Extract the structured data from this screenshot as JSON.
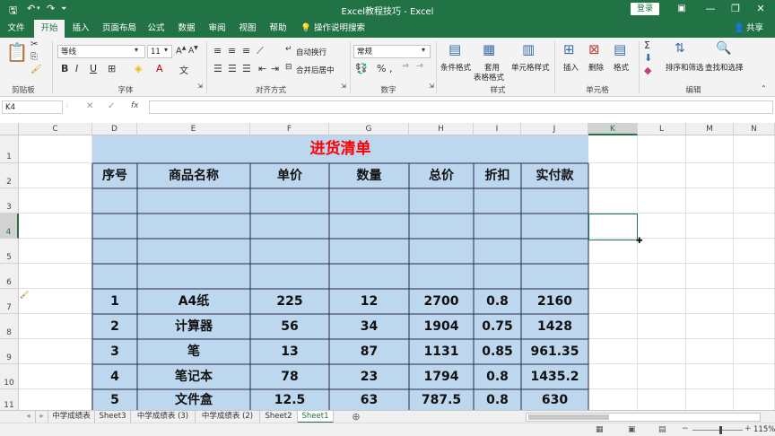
{
  "window": {
    "title": "Excel教程技巧 - Excel",
    "login": "登录",
    "share": "共享"
  },
  "tabs": [
    "文件",
    "开始",
    "插入",
    "页面布局",
    "公式",
    "数据",
    "审阅",
    "视图",
    "帮助",
    "操作说明搜索"
  ],
  "ribbon": {
    "clipboard": {
      "label": "剪贴板"
    },
    "font": {
      "label": "字体",
      "name": "等线",
      "size": "11"
    },
    "alignment": {
      "label": "对齐方式",
      "wrap": "自动换行",
      "merge": "合并后居中"
    },
    "number": {
      "label": "数字",
      "format": "常规"
    },
    "styles": {
      "label": "样式",
      "conditional": "条件格式",
      "table1": "套用",
      "table2": "表格格式",
      "cell": "单元格样式"
    },
    "cells": {
      "label": "单元格",
      "insert": "插入",
      "delete": "删除",
      "format": "格式"
    },
    "editing": {
      "label": "编辑",
      "sort": "排序和筛选",
      "find": "查找和选择"
    }
  },
  "formula_bar": {
    "name_box": "K4",
    "fx": "fx",
    "value": ""
  },
  "columns": [
    "C",
    "D",
    "E",
    "F",
    "G",
    "H",
    "I",
    "J",
    "K",
    "L",
    "M",
    "N"
  ],
  "rows": [
    "1",
    "2",
    "3",
    "4",
    "5",
    "6",
    "7",
    "8",
    "9",
    "10",
    "11"
  ],
  "table": {
    "title": "进货清单",
    "headers": [
      "序号",
      "商品名称",
      "单价",
      "数量",
      "总价",
      "折扣",
      "实付款"
    ],
    "data": [
      [
        "1",
        "A4纸",
        "225",
        "12",
        "2700",
        "0.8",
        "2160"
      ],
      [
        "2",
        "计算器",
        "56",
        "34",
        "1904",
        "0.75",
        "1428"
      ],
      [
        "3",
        "笔",
        "13",
        "87",
        "1131",
        "0.85",
        "961.35"
      ],
      [
        "4",
        "笔记本",
        "78",
        "23",
        "1794",
        "0.8",
        "1435.2"
      ],
      [
        "5",
        "文件盒",
        "12.5",
        "63",
        "787.5",
        "0.8",
        "630"
      ]
    ]
  },
  "sheets": [
    "中学成绩表",
    "Sheet3",
    "中学成绩表 (3)",
    "中学成绩表 (2)",
    "Sheet2",
    "Sheet1"
  ],
  "active_sheet": "Sheet1",
  "zoom": "115%",
  "colors": {
    "accent": "#217346",
    "table_fill": "#bdd7ee",
    "title_red": "#ff0000"
  }
}
